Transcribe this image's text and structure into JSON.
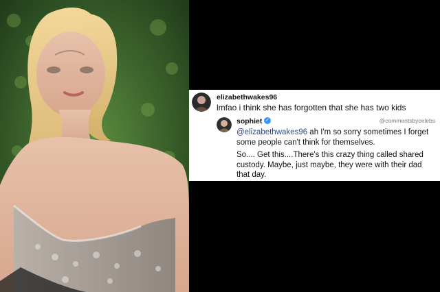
{
  "comments": [
    {
      "username": "elizabethwakes96",
      "text": "lmfao i think she has forgotten that she has two kids"
    }
  ],
  "reply": {
    "username": "sophiet",
    "verified": true,
    "mention": "@elizabethwakes96",
    "line1": " ah I'm so sorry sometimes I forget some people can't think for themselves.",
    "line2": "So.... Get this....There's this crazy thing called shared custody. Maybe, just maybe, they were with their dad that day."
  },
  "watermark": "@commentsbycelebs"
}
